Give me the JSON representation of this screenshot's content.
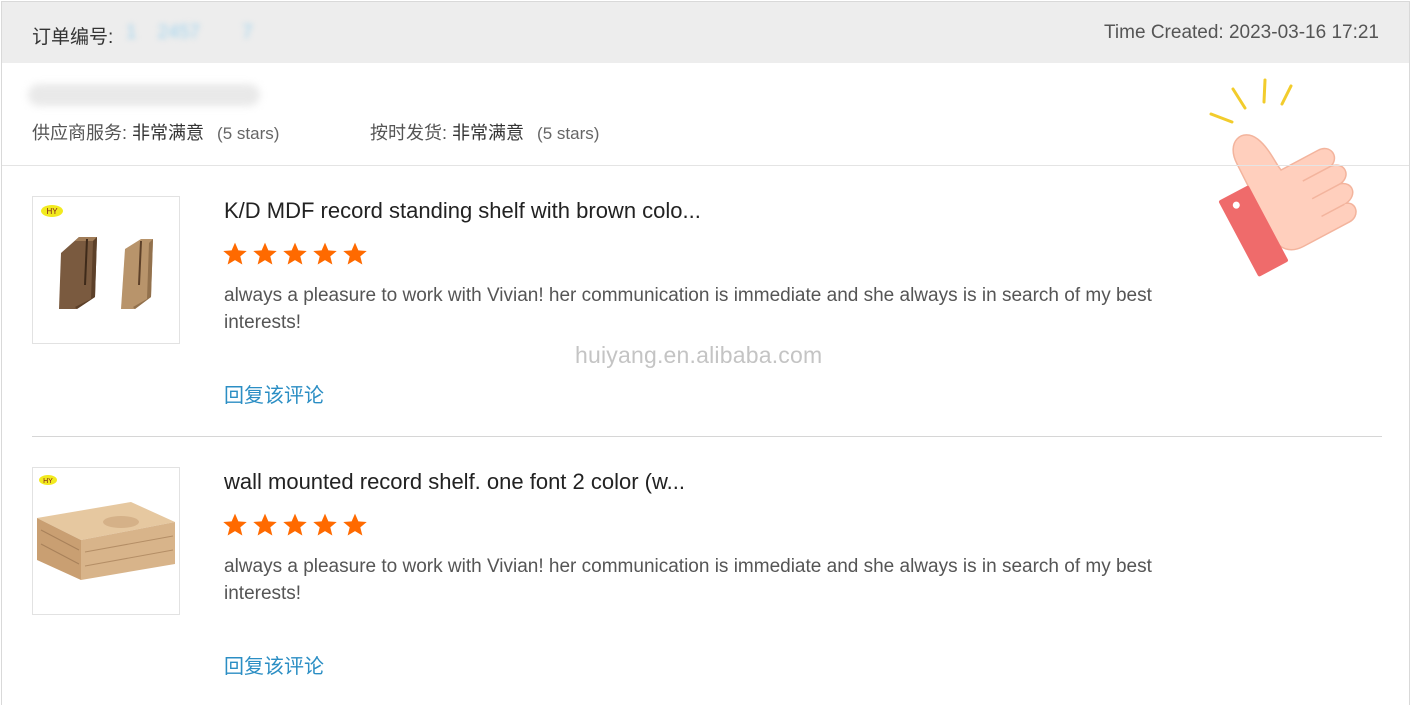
{
  "header": {
    "order_label": "订单编号:",
    "order_number": "1    2457        7",
    "time_created": "Time Created: 2023-03-16 17:21"
  },
  "ratings": {
    "supplier": {
      "label": "供应商服务:",
      "value": "非常满意",
      "stars": "(5 stars)"
    },
    "delivery": {
      "label": "按时发货:",
      "value": "非常满意",
      "stars": "(5 stars)"
    }
  },
  "reviews": [
    {
      "title": "K/D MDF record standing shelf with brown colo...",
      "rating": 5,
      "text": "always a pleasure to work with Vivian! her communication is immediate and she always is in search of my best interests!",
      "reply_label": "回复该评论",
      "logo": "HY"
    },
    {
      "title": "wall mounted record shelf. one font 2 color (w...",
      "rating": 5,
      "text": "always a pleasure to work with Vivian! her communication is immediate and she always is in search of my best interests!",
      "reply_label": "回复该评论",
      "logo": "HY"
    }
  ],
  "watermark": "huiyang.en.alibaba.com",
  "colors": {
    "star": "#ff6a00",
    "link": "#2b8ec4",
    "header_bg": "#ededed"
  },
  "icons": {
    "decoration": "thumbs-up-icon",
    "rating": "star-icon"
  }
}
